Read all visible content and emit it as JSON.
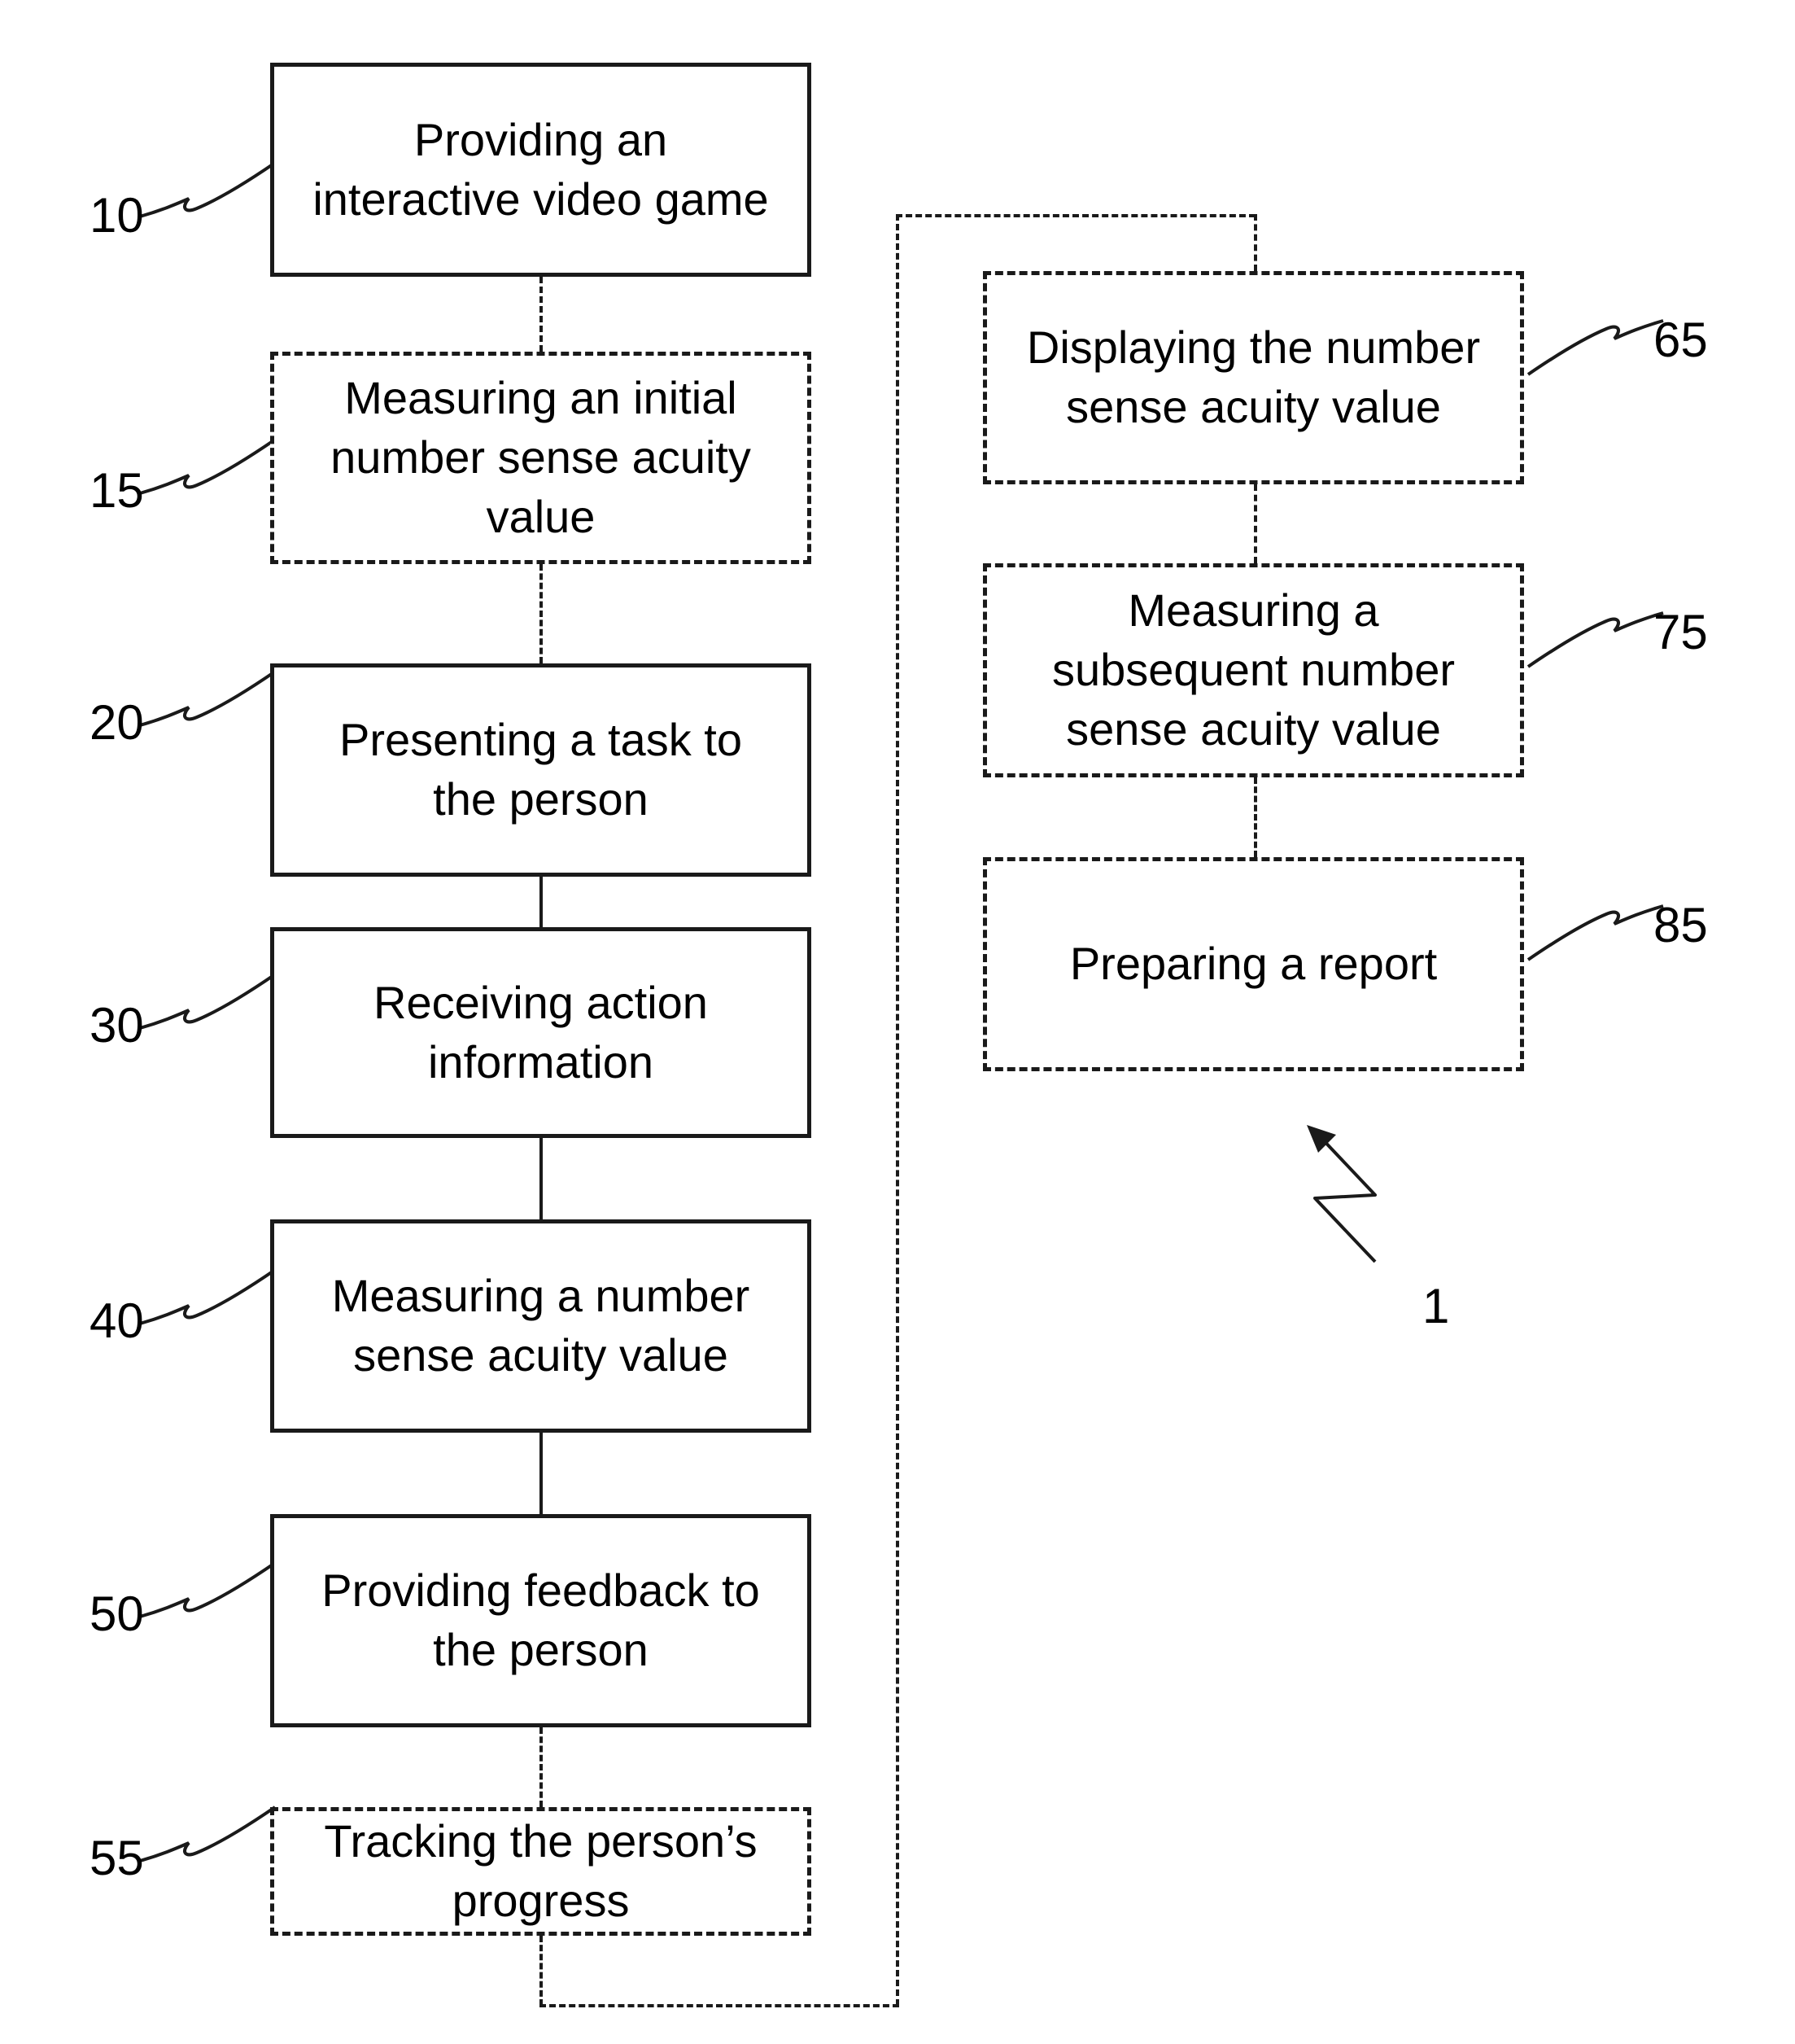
{
  "figure": {
    "type": "patent-flowchart",
    "reference_numeral_main": "1"
  },
  "nodes": [
    {
      "id": "10",
      "ref": "10",
      "style": "solid",
      "label": "Providing an\ninteractive video game"
    },
    {
      "id": "15",
      "ref": "15",
      "style": "dashed",
      "label": "Measuring an initial\nnumber sense acuity\nvalue"
    },
    {
      "id": "20",
      "ref": "20",
      "style": "solid",
      "label": "Presenting a task to\nthe person"
    },
    {
      "id": "30",
      "ref": "30",
      "style": "solid",
      "label": "Receiving action\ninformation"
    },
    {
      "id": "40",
      "ref": "40",
      "style": "solid",
      "label": "Measuring a number\nsense acuity value"
    },
    {
      "id": "50",
      "ref": "50",
      "style": "solid",
      "label": "Providing feedback to\nthe person"
    },
    {
      "id": "55",
      "ref": "55",
      "style": "dashed",
      "label": "Tracking the person’s\nprogress"
    },
    {
      "id": "65",
      "ref": "65",
      "style": "dashed",
      "label": "Displaying the number\nsense acuity value"
    },
    {
      "id": "75",
      "ref": "75",
      "style": "dashed",
      "label": "Measuring a\nsubsequent number\nsense acuity value"
    },
    {
      "id": "85",
      "ref": "85",
      "style": "dashed",
      "label": "Preparing a report"
    }
  ],
  "colors": {
    "stroke": "#1a1a1a",
    "background": "#ffffff",
    "text": "#000000"
  }
}
